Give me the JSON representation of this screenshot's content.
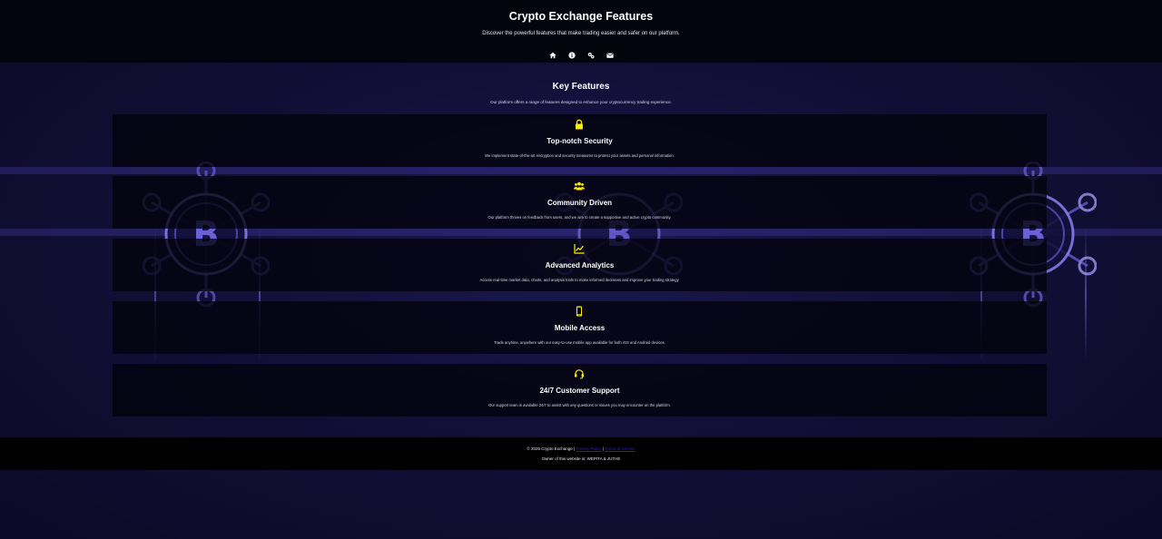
{
  "header": {
    "title": "Crypto Exchange Features",
    "subtitle": "Discover the powerful features that make trading easier and safer on our platform.",
    "nav": [
      {
        "icon": "home-icon"
      },
      {
        "icon": "info-icon"
      },
      {
        "icon": "gears-icon"
      },
      {
        "icon": "envelope-icon"
      }
    ]
  },
  "features": {
    "heading": "Key Features",
    "intro": "Our platform offers a range of features designed to enhance your cryptocurrency trading experience.",
    "cards": [
      {
        "icon": "lock-icon",
        "title": "Top-notch Security",
        "text": "We implement state-of-the-art encryption and security measures to protect your assets and personal information."
      },
      {
        "icon": "users-icon",
        "title": "Community Driven",
        "text": "Our platform thrives on feedback from users, and we aim to create a supportive and active crypto community."
      },
      {
        "icon": "chart-line-icon",
        "title": "Advanced Analytics",
        "text": "Access real-time market data, charts, and analysis tools to make informed decisions and improve your trading strategy."
      },
      {
        "icon": "mobile-icon",
        "title": "Mobile Access",
        "text": "Trade anytime, anywhere with our easy-to-use mobile app available for both iOS and Android devices."
      },
      {
        "icon": "headset-icon",
        "title": "24/7 Customer Support",
        "text": "Our support team is available 24/7 to assist with any questions or issues you may encounter on the platform."
      }
    ]
  },
  "footer": {
    "copyright": "© 2025 Crypto Exchange |",
    "privacy_link": "Privacy Policy",
    "separator": "|",
    "terms_link": "Terms of Service",
    "owner": "Owner of this website is: WEPITA & JUTHE"
  },
  "colors": {
    "accent": "#ffee00",
    "header_bg": "#04040e",
    "page_bg": "#0e0c2a",
    "link": "#2020d0"
  }
}
